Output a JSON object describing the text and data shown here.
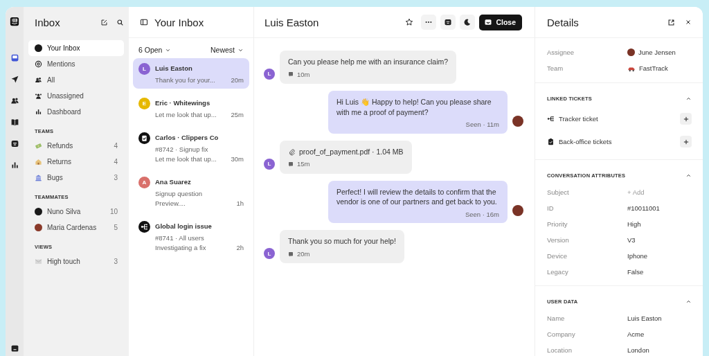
{
  "rail": {
    "items": [
      {
        "selected": true
      },
      {
        "selected": false
      },
      {
        "selected": false
      },
      {
        "selected": false
      },
      {
        "selected": false
      },
      {
        "selected": false
      }
    ]
  },
  "nav": {
    "title": "Inbox",
    "items": [
      {
        "label": "Your Inbox",
        "selected": true
      },
      {
        "label": "Mentions",
        "selected": false
      },
      {
        "label": "All",
        "selected": false
      },
      {
        "label": "Unassigned",
        "selected": false
      },
      {
        "label": "Dashboard",
        "selected": false
      }
    ],
    "sections": [
      {
        "heading": "TEAMS",
        "items": [
          {
            "label": "Refunds",
            "count": "4"
          },
          {
            "label": "Returns",
            "count": "4"
          },
          {
            "label": "Bugs",
            "count": "3"
          }
        ]
      },
      {
        "heading": "TEAMMATES",
        "items": [
          {
            "label": "Nuno Silva",
            "count": "10"
          },
          {
            "label": "Maria Cardenas",
            "count": "5"
          }
        ]
      },
      {
        "heading": "VIEWS",
        "items": [
          {
            "label": "High touch",
            "count": "3"
          }
        ]
      }
    ]
  },
  "list": {
    "title": "Your Inbox",
    "filter": "6 Open",
    "sort": "Newest",
    "conversations": [
      {
        "kind": "letter",
        "letter": "L",
        "color": "#8a63d2",
        "name": "Luis Easton",
        "lines": [
          "Thank you for your..."
        ],
        "time": "20m",
        "selected": true
      },
      {
        "kind": "letter",
        "letter": "E",
        "color": "#e6b800",
        "name": "Eric · Whitewings",
        "lines": [
          "Let me look that up..."
        ],
        "time": "25m",
        "selected": false
      },
      {
        "kind": "ticket",
        "name": "Carlos · Clippers Co",
        "lines": [
          "#8742  · Signup fix",
          "Let me look that up..."
        ],
        "time": "30m",
        "selected": false
      },
      {
        "kind": "letter",
        "letter": "A",
        "color": "#d9706b",
        "name": "Ana Suarez",
        "lines": [
          "Signup question",
          "Preview...."
        ],
        "time": "1h",
        "selected": false
      },
      {
        "kind": "tracker",
        "name": "Global login issue",
        "lines": [
          "#8741 · All users",
          "Investigating a fix"
        ],
        "time": "2h",
        "selected": false
      }
    ]
  },
  "chat": {
    "title": "Luis Easton",
    "close": "Close",
    "messages": [
      {
        "outgoing": false,
        "kind": "text",
        "text": "Can you please help me with an insurance claim?",
        "meta": "10m",
        "letter": "L"
      },
      {
        "outgoing": true,
        "kind": "text",
        "text": "Hi Luis 👋 Happy to help! Can you please share with me a proof of payment?",
        "meta": "Seen · 11m"
      },
      {
        "outgoing": false,
        "kind": "file",
        "text": "proof_of_payment.pdf · 1.04 MB",
        "meta": "15m",
        "letter": "L"
      },
      {
        "outgoing": true,
        "kind": "text",
        "text": "Perfect! I will review the details to confirm that the vendor is one of our partners and get back to you.",
        "meta": "Seen · 16m"
      },
      {
        "outgoing": false,
        "kind": "text",
        "text": "Thank you so much for your help!",
        "meta": "20m",
        "letter": "L"
      }
    ]
  },
  "details": {
    "title": "Details",
    "summary": [
      {
        "label": "Assignee",
        "value": "June Jensen",
        "kind": "person"
      },
      {
        "label": "Team",
        "value": "FastTrack",
        "kind": "team"
      }
    ],
    "sections": [
      {
        "heading": "LINKED TICKETS",
        "expanded": true,
        "kind": "links",
        "items": [
          {
            "label": "Tracker ticket",
            "kind": "tracker"
          },
          {
            "label": "Back-office tickets",
            "kind": "backoffice"
          }
        ]
      },
      {
        "heading": "CONVERSATION ATTRIBUTES",
        "expanded": true,
        "kind": "attrs",
        "rows": [
          {
            "label": "Subject",
            "value": "+ Add",
            "muted": true
          },
          {
            "label": "ID",
            "value": "#10011001",
            "muted": false
          },
          {
            "label": "Priority",
            "value": "High",
            "muted": false
          },
          {
            "label": "Version",
            "value": "V3",
            "muted": false
          },
          {
            "label": "Device",
            "value": "Iphone",
            "muted": false
          },
          {
            "label": "Legacy",
            "value": "False",
            "muted": false
          }
        ]
      },
      {
        "heading": "USER DATA",
        "expanded": true,
        "kind": "attrs",
        "rows": [
          {
            "label": "Name",
            "value": "Luis Easton",
            "muted": false
          },
          {
            "label": "Company",
            "value": "Acme",
            "muted": false
          },
          {
            "label": "Location",
            "value": "London",
            "muted": false
          }
        ]
      }
    ]
  }
}
